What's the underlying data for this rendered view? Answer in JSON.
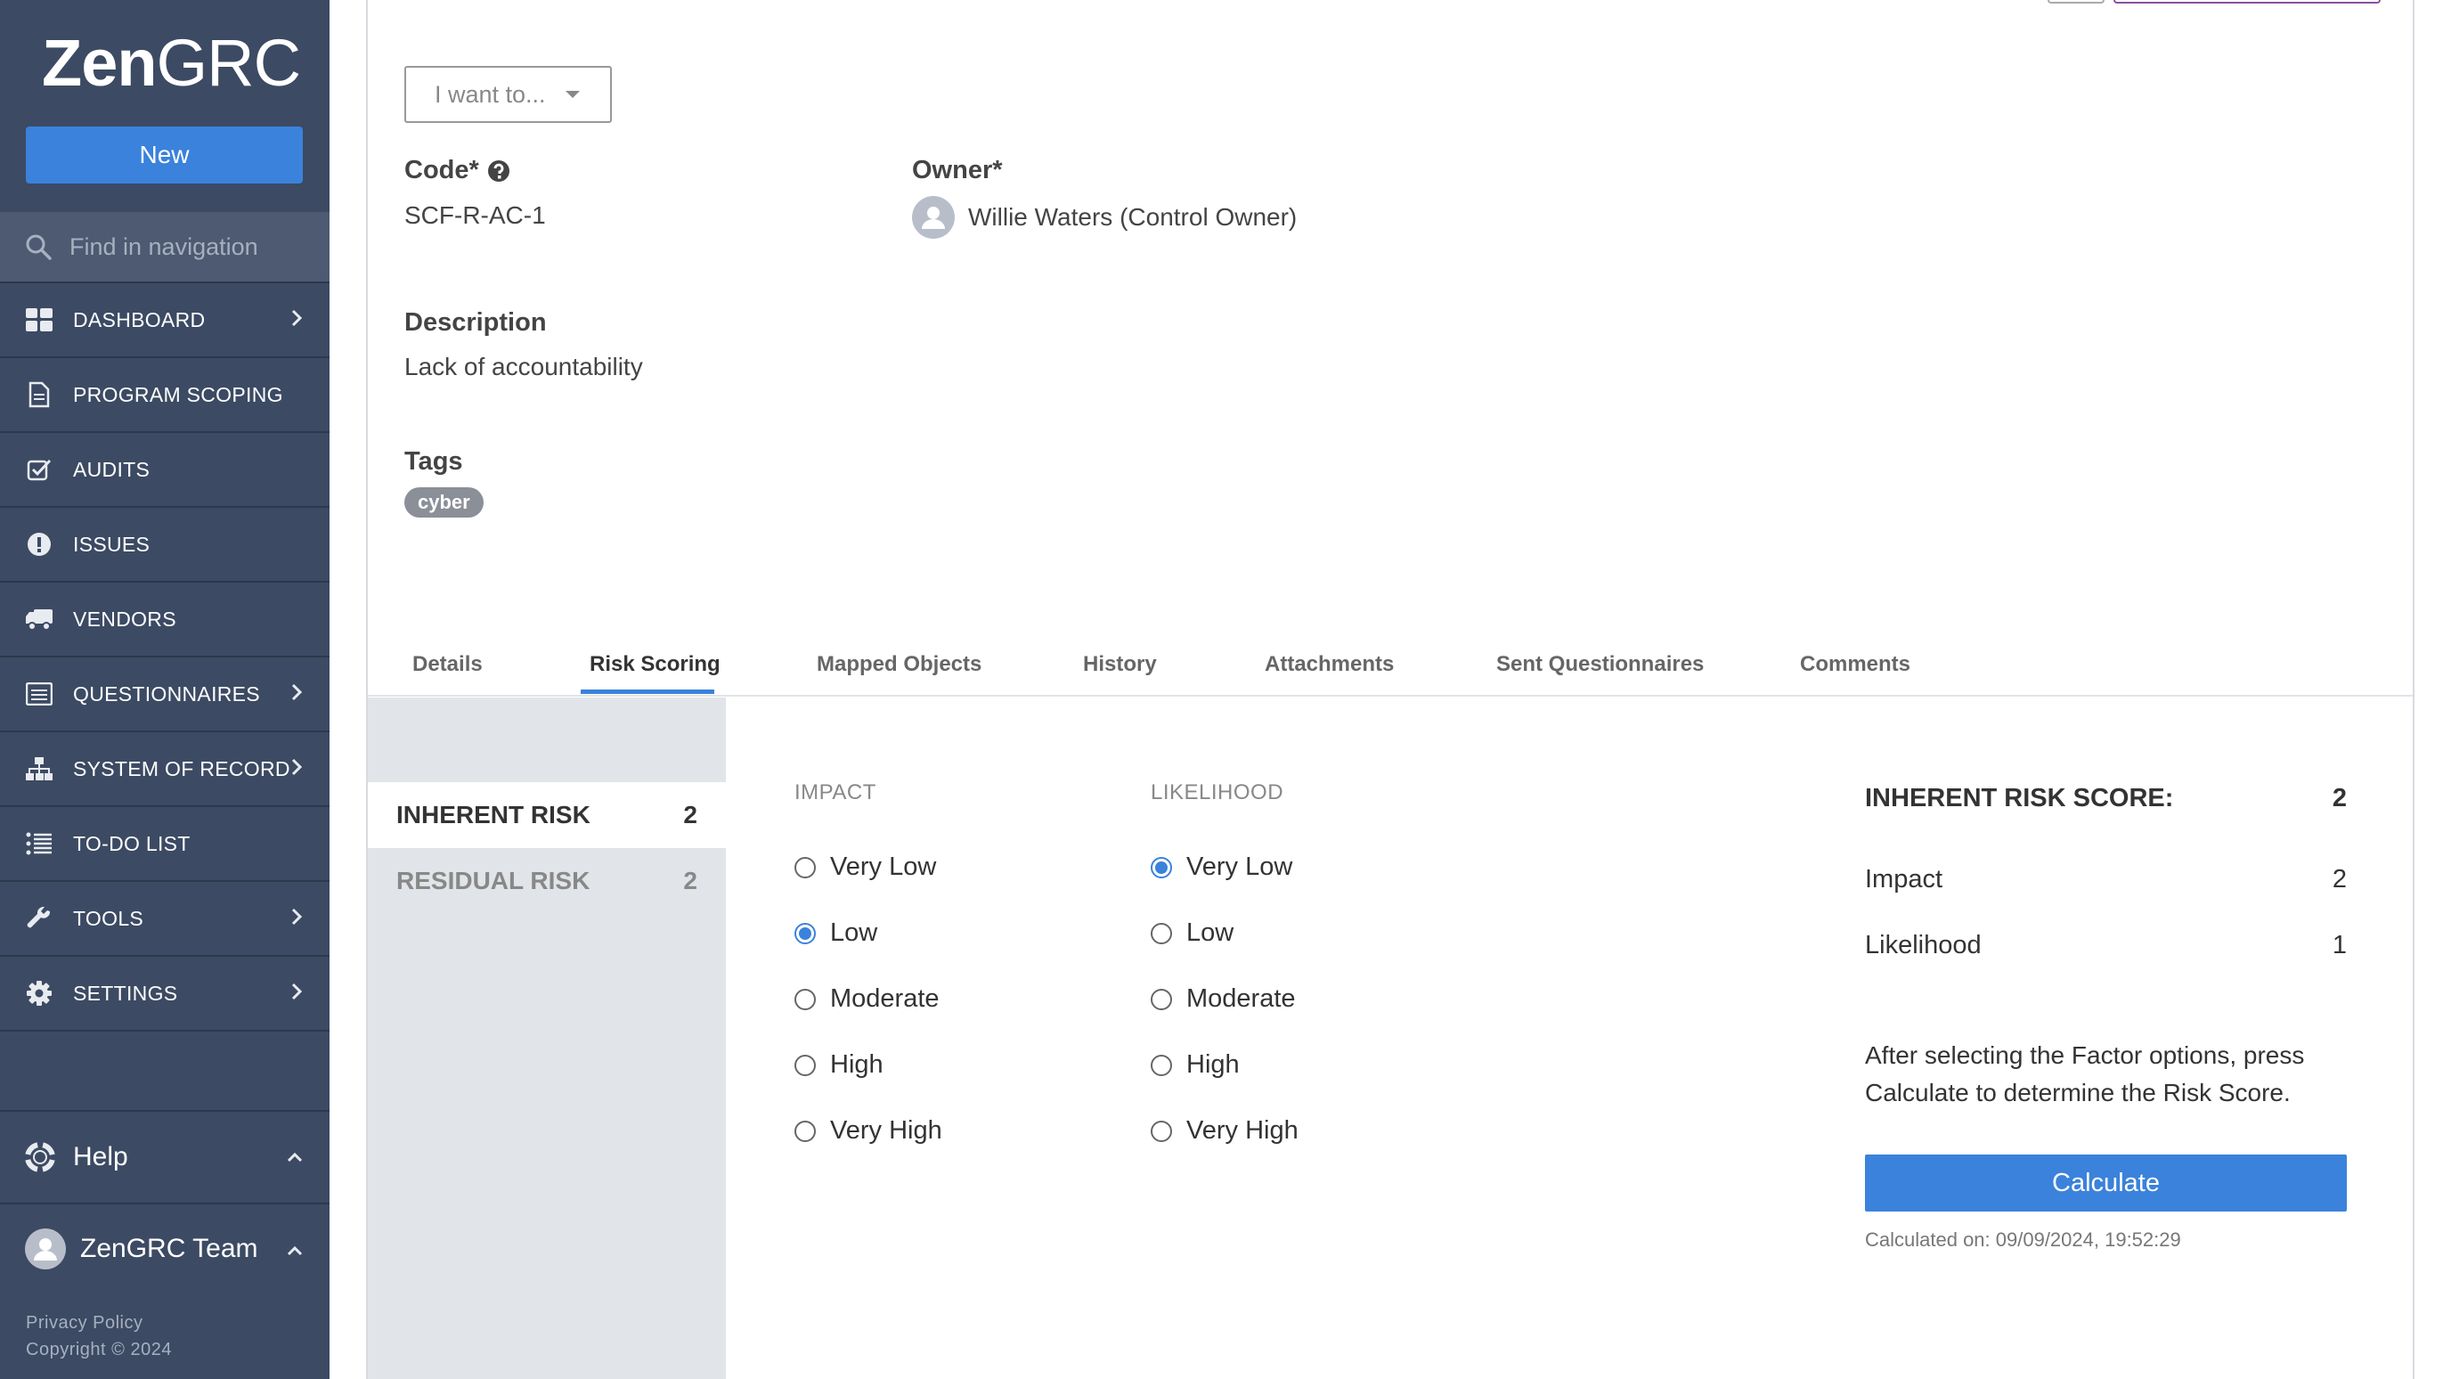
{
  "sidebar": {
    "logo_bold": "Zen",
    "logo_light": "GRC",
    "new_label": "New",
    "search_placeholder": "Find in navigation",
    "items": [
      {
        "label": "DASHBOARD",
        "icon": "dashboard-icon",
        "has_children": true
      },
      {
        "label": "PROGRAM SCOPING",
        "icon": "document-icon",
        "has_children": false
      },
      {
        "label": "AUDITS",
        "icon": "checkbox-icon",
        "has_children": false
      },
      {
        "label": "ISSUES",
        "icon": "exclamation-icon",
        "has_children": false
      },
      {
        "label": "VENDORS",
        "icon": "truck-icon",
        "has_children": false
      },
      {
        "label": "QUESTIONNAIRES",
        "icon": "list-icon",
        "has_children": true
      },
      {
        "label": "SYSTEM OF RECORD",
        "icon": "sitemap-icon",
        "has_children": true
      },
      {
        "label": "TO-DO LIST",
        "icon": "todo-icon",
        "has_children": false
      },
      {
        "label": "TOOLS",
        "icon": "wrench-icon",
        "has_children": true
      },
      {
        "label": "SETTINGS",
        "icon": "gear-icon",
        "has_children": true
      }
    ],
    "help_label": "Help",
    "user_label": "ZenGRC Team",
    "privacy": "Privacy Policy",
    "copyright": "Copyright © 2024"
  },
  "record": {
    "action_dropdown": "I want to...",
    "code_label": "Code*",
    "code_value": "SCF-R-AC-1",
    "owner_label": "Owner*",
    "owner_value": "Willie Waters (Control Owner)",
    "description_label": "Description",
    "description_value": "Lack of accountability",
    "tags_label": "Tags",
    "tags": [
      "cyber"
    ]
  },
  "tabs": [
    "Details",
    "Risk Scoring",
    "Mapped Objects",
    "History",
    "Attachments",
    "Sent Questionnaires",
    "Comments"
  ],
  "active_tab": "Risk Scoring",
  "risk_types": [
    {
      "label": "INHERENT RISK",
      "score": "2",
      "selected": true
    },
    {
      "label": "RESIDUAL RISK",
      "score": "2",
      "selected": false
    }
  ],
  "factors": {
    "impact_header": "IMPACT",
    "likelihood_header": "LIKELIHOOD",
    "options": [
      "Very Low",
      "Low",
      "Moderate",
      "High",
      "Very High"
    ],
    "impact_selected": "Low",
    "likelihood_selected": "Very Low"
  },
  "score": {
    "title": "INHERENT RISK SCORE:",
    "total": "2",
    "impact_label": "Impact",
    "impact_value": "2",
    "likelihood_label": "Likelihood",
    "likelihood_value": "1",
    "hint": "After selecting the Factor options, press Calculate to determine the Risk Score.",
    "calculate_label": "Calculate",
    "calculated_on": "Calculated on: 09/09/2024, 19:52:29"
  },
  "colors": {
    "sidebar": "#3c4a63",
    "accent": "#3a82db"
  }
}
